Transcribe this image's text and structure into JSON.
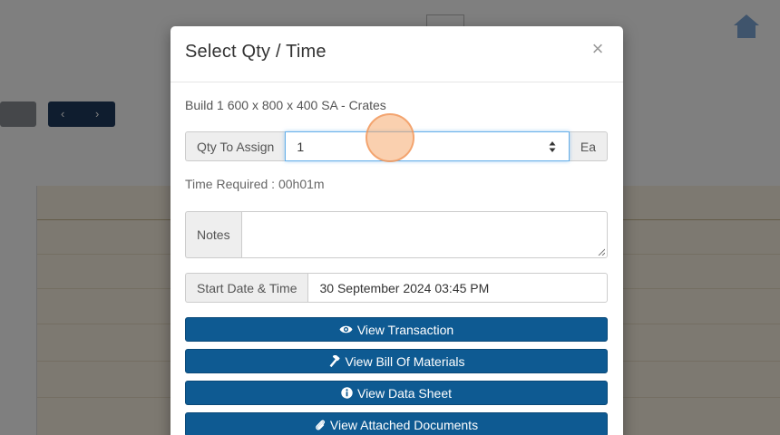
{
  "modal": {
    "title": "Select Qty / Time",
    "close_symbol": "×",
    "build_description": "Build 1 600 x 800 x 400 SA - Crates",
    "qty": {
      "label": "Qty To Assign",
      "value": "1",
      "unit": "Ea"
    },
    "time_required": {
      "label": "Time Required :",
      "value": "00h01m"
    },
    "notes": {
      "label": "Notes",
      "value": ""
    },
    "start": {
      "label": "Start Date & Time",
      "value": "30 September 2024 03:45 PM"
    },
    "buttons": [
      {
        "label": "View Transaction",
        "icon": "eye-icon"
      },
      {
        "label": "View Bill Of Materials",
        "icon": "hammer-icon"
      },
      {
        "label": "View Data Sheet",
        "icon": "info-icon"
      },
      {
        "label": "View Attached Documents",
        "icon": "paperclip-icon"
      }
    ]
  },
  "colors": {
    "primary_button": "#0e5a92",
    "overlay": "rgba(0,0,0,0.5)",
    "focus_border": "#66afe9",
    "click_indicator": "#f6aa6e"
  }
}
